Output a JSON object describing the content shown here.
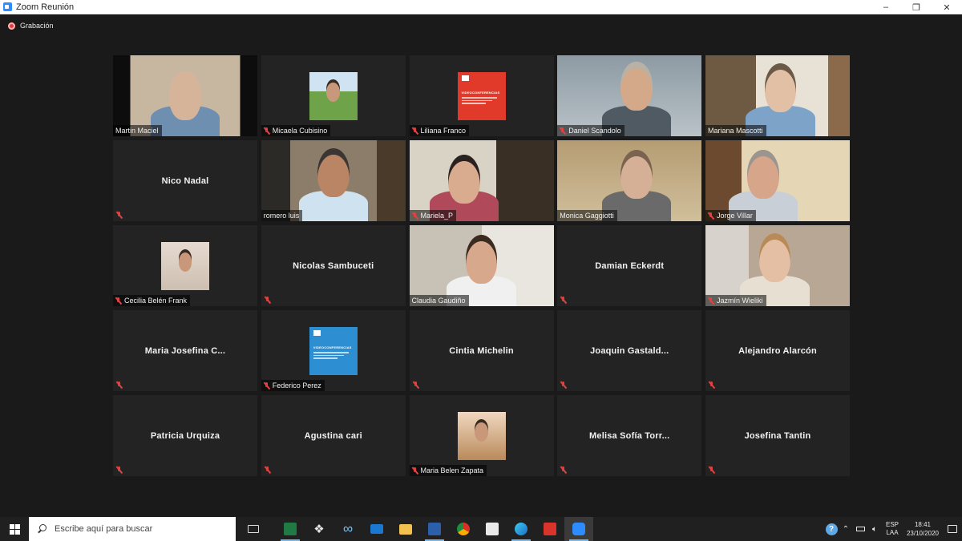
{
  "window": {
    "title": "Zoom Reunión",
    "controls": [
      "–",
      "❐",
      "✕"
    ]
  },
  "recording": {
    "label": "Grabación"
  },
  "participants": [
    {
      "name": "Martin Maciel",
      "display": "",
      "muted": false
    },
    {
      "name": "Micaela Cubisino",
      "display": "",
      "muted": true
    },
    {
      "name": "Liliana Franco",
      "display": "",
      "muted": true
    },
    {
      "name": "Daniel Scandolo",
      "display": "",
      "muted": true
    },
    {
      "name": "Mariana Mascotti",
      "display": "",
      "muted": false
    },
    {
      "name": "",
      "display": "Nico Nadal",
      "muted": true
    },
    {
      "name": "romero luis",
      "display": "",
      "muted": false
    },
    {
      "name": "Mariela_P",
      "display": "",
      "muted": true
    },
    {
      "name": "Monica Gaggiotti",
      "display": "",
      "muted": false
    },
    {
      "name": "Jorge Villar",
      "display": "",
      "muted": true
    },
    {
      "name": "Cecilia Belén Frank",
      "display": "",
      "muted": true
    },
    {
      "name": "",
      "display": "Nicolas Sambuceti",
      "muted": true
    },
    {
      "name": "Claudia Gaudiño",
      "display": "",
      "muted": false
    },
    {
      "name": "",
      "display": "Damian Eckerdt",
      "muted": true
    },
    {
      "name": "Jazmín Wieliki",
      "display": "",
      "muted": true
    },
    {
      "name": "",
      "display": "Maria Josefina C...",
      "muted": true
    },
    {
      "name": "Federico Perez",
      "display": "",
      "muted": true
    },
    {
      "name": "",
      "display": "Cintia Michelin",
      "muted": true
    },
    {
      "name": "",
      "display": "Joaquin Gastald...",
      "muted": true
    },
    {
      "name": "",
      "display": "Alejandro Alarcón",
      "muted": true
    },
    {
      "name": "",
      "display": "Patricia Urquiza",
      "muted": true
    },
    {
      "name": "",
      "display": "Agustina cari",
      "muted": true
    },
    {
      "name": "Maria Belen Zapata",
      "display": "",
      "muted": true
    },
    {
      "name": "",
      "display": "Melisa Sofía Torr...",
      "muted": true
    },
    {
      "name": "",
      "display": "Josefina Tantin",
      "muted": true
    }
  ],
  "video_card": {
    "heading": "VIDEOCONFERENCIAS"
  },
  "taskbar": {
    "search_placeholder": "Escribe aquí para buscar",
    "apps": [
      "task-view",
      "excel",
      "dropbox",
      "infinity",
      "mail",
      "file-explorer",
      "word",
      "chrome",
      "store",
      "edge",
      "acrobat",
      "zoom"
    ],
    "tray": {
      "lang_1": "ESP",
      "lang_2": "LAA",
      "time": "18:41",
      "date": "23/10/2020"
    }
  },
  "colors": {
    "accent_active_speaker": "#b7e44a",
    "mute_red": "#e34141",
    "zoom_blue": "#2d8cff"
  }
}
